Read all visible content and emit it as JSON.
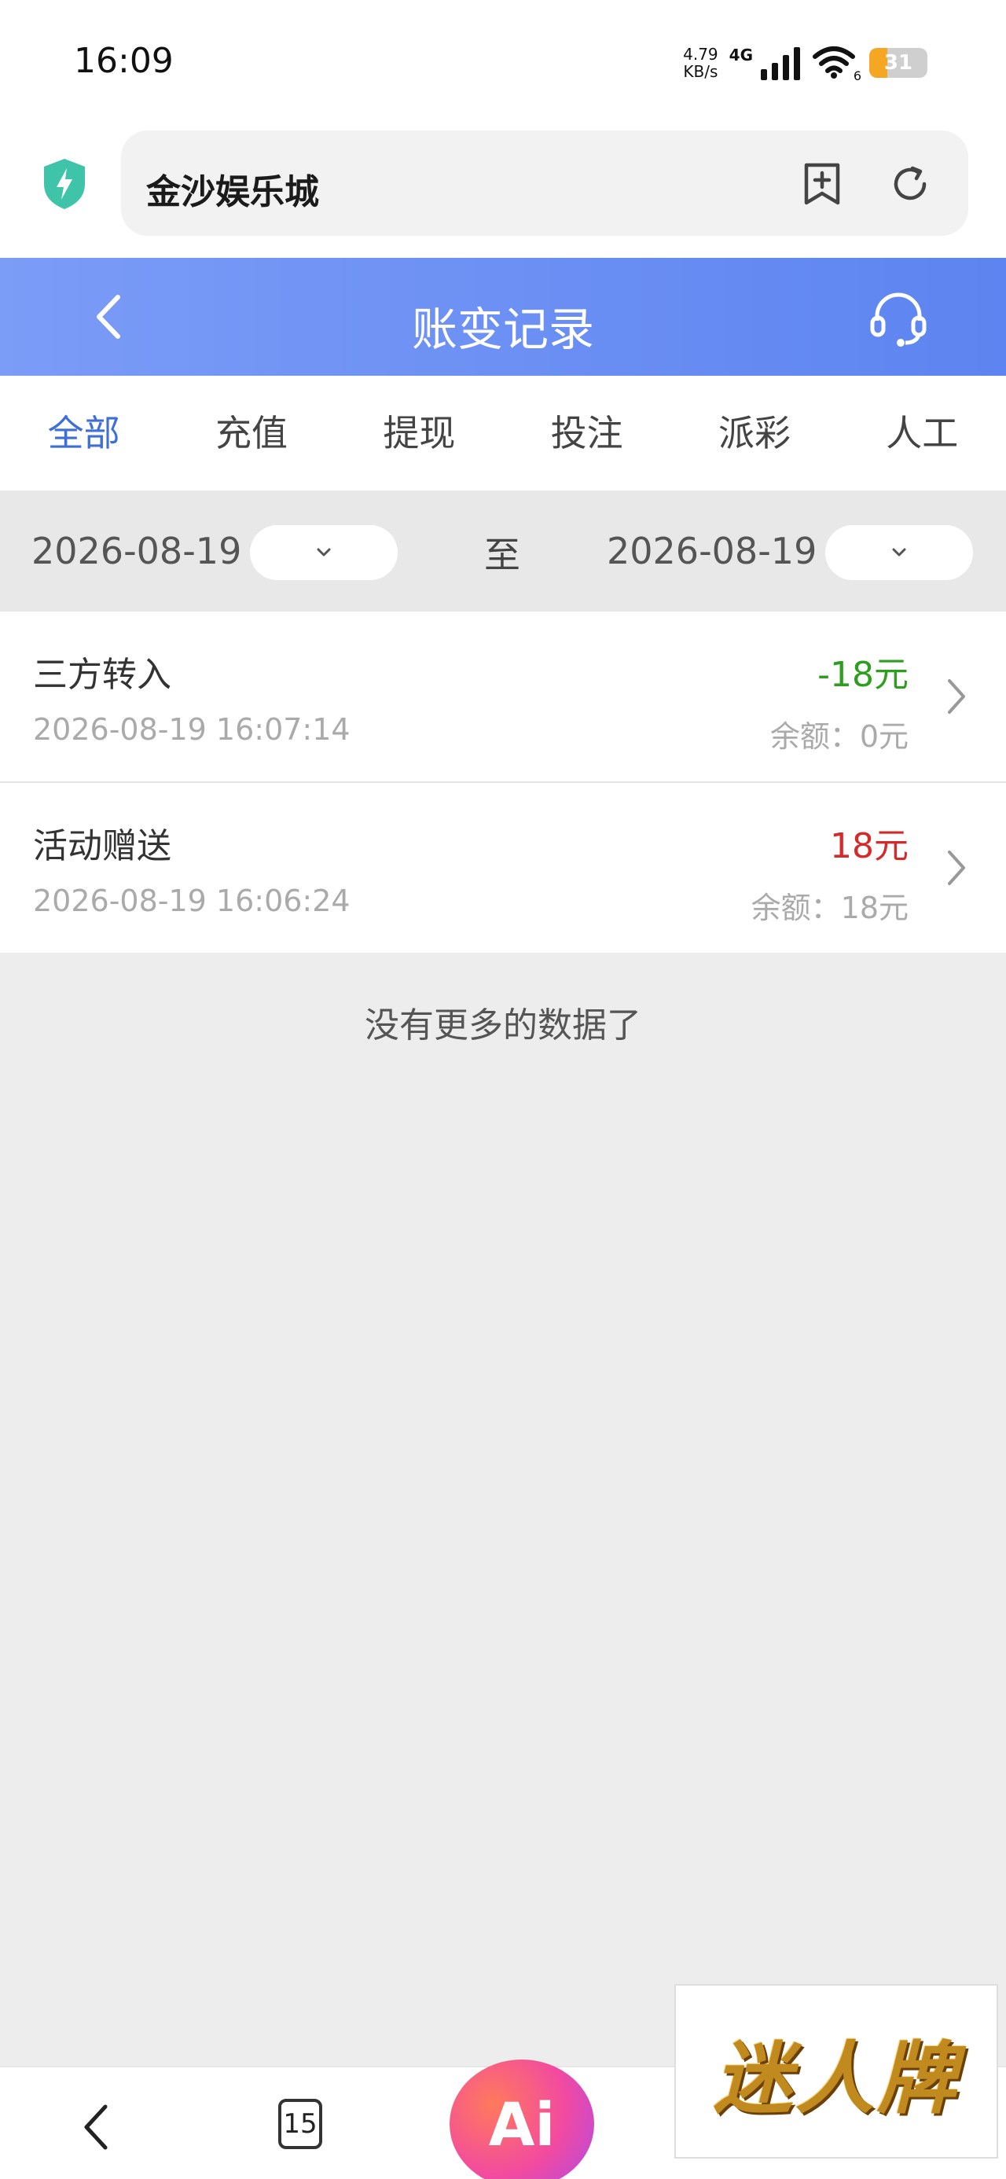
{
  "status_bar": {
    "time": "16:09",
    "net_speed_value": "4.79",
    "net_speed_unit": "KB/s",
    "network": "4G",
    "wifi_sub": "6",
    "battery_level": "31",
    "battery_fraction": 0.31,
    "battery_color": "#f5a623"
  },
  "browser": {
    "url_text": "金沙娱乐城",
    "icons": [
      "shield-bolt-icon",
      "bookmark-add-icon",
      "refresh-icon"
    ]
  },
  "header": {
    "title": "账变记录",
    "background": "#6a8ef4",
    "icons": [
      "back-icon",
      "headset-icon"
    ]
  },
  "tabs": [
    {
      "label": "全部",
      "active": true
    },
    {
      "label": "充值",
      "active": false
    },
    {
      "label": "提现",
      "active": false
    },
    {
      "label": "投注",
      "active": false
    },
    {
      "label": "派彩",
      "active": false
    },
    {
      "label": "人工",
      "active": false
    }
  ],
  "filter": {
    "start_date": "2026-08-19",
    "separator": "至",
    "end_date": "2026-08-19"
  },
  "records": [
    {
      "type": "三方转入",
      "time": "2026-08-19 16:07:14",
      "amount": "-18元",
      "amount_color": "#2e9e1f",
      "balance": "余额：0元"
    },
    {
      "type": "活动赠送",
      "time": "2026-08-19 16:06:24",
      "amount": "18元",
      "amount_color": "#d62a2a",
      "balance": "余额：18元"
    }
  ],
  "no_more": "没有更多的数据了",
  "bottom_nav": {
    "tab_count": "15",
    "ai_label": "Ai"
  },
  "watermark": {
    "text": "迷人牌"
  }
}
